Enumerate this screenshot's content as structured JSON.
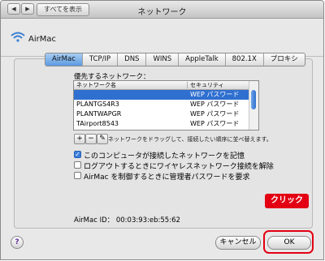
{
  "window": {
    "title": "ネットワーク"
  },
  "toolbar": {
    "back": "◀",
    "forward": "▶",
    "show_all": "すべてを表示"
  },
  "header": {
    "port": "AirMac"
  },
  "tabs": [
    "AirMac",
    "TCP/IP",
    "DNS",
    "WINS",
    "AppleTalk",
    "802.1X",
    "プロキシ"
  ],
  "selected_tab": "AirMac",
  "networks": {
    "label": "優先するネットワーク：",
    "columns": [
      "ネットワーク名",
      "セキュリティ"
    ],
    "rows": [
      {
        "name": "",
        "security": "WEP パスワード",
        "selected": true
      },
      {
        "name": "PLANTGS4R3",
        "security": "WEP パスワード"
      },
      {
        "name": "PLANTWAPGR",
        "security": "WEP パスワード"
      },
      {
        "name": "TAirport8543",
        "security": "WEP パスワード"
      }
    ],
    "buttons": {
      "add": "+",
      "remove": "−",
      "edit": "✎"
    },
    "hint": "ネットワークをドラッグして、接続したい順序に並べ替えます。"
  },
  "options": [
    {
      "label": "このコンピュータが接続したネットワークを記憶",
      "checked": true
    },
    {
      "label": "ログアウトするときにワイヤレスネットワーク接続を解除",
      "checked": false
    },
    {
      "label": "AirMac を制御するときに管理者パスワードを要求",
      "checked": false
    }
  ],
  "airmac_id": {
    "label": "AirMac ID：",
    "value": "00:03:93:eb:55:62"
  },
  "footer": {
    "help": "?",
    "cancel": "キャンセル",
    "ok": "OK"
  },
  "annotation": {
    "text": "クリック"
  },
  "colors": {
    "highlight": "#e30012",
    "selection": "#2f6fd0"
  }
}
